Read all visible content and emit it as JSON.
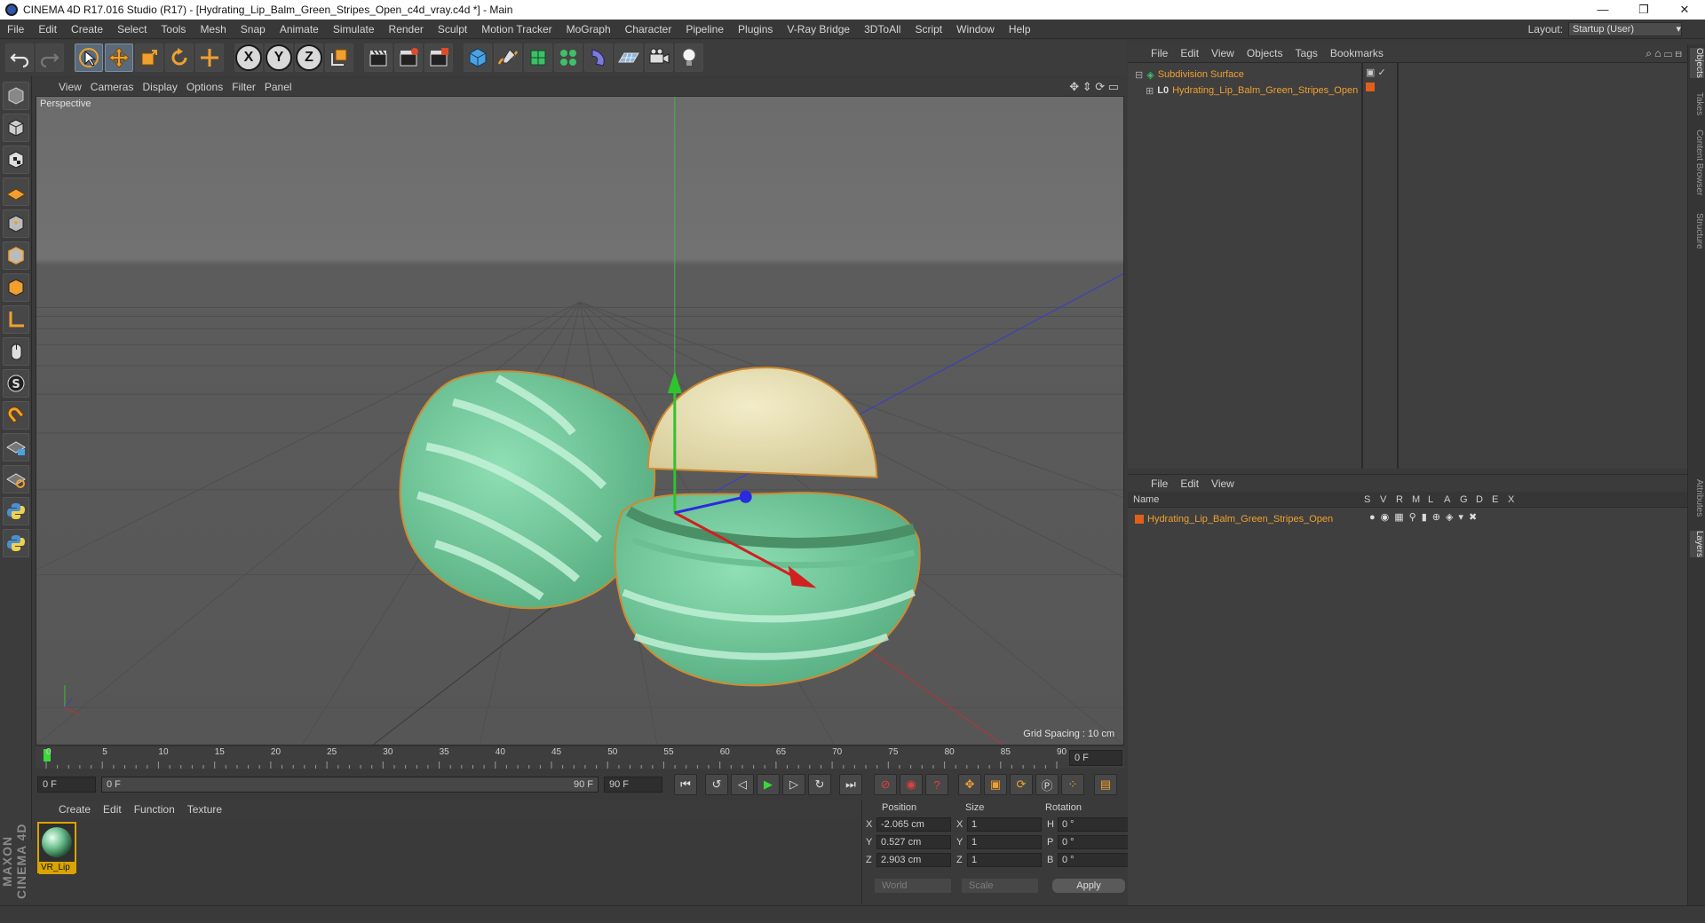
{
  "window": {
    "title": "CINEMA 4D R17.016 Studio (R17) - [Hydrating_Lip_Balm_Green_Stripes_Open_c4d_vray.c4d *] - Main",
    "controls": [
      "—",
      "❐",
      "✕"
    ]
  },
  "menu": {
    "items": [
      "File",
      "Edit",
      "Create",
      "Select",
      "Tools",
      "Mesh",
      "Snap",
      "Animate",
      "Simulate",
      "Render",
      "Sculpt",
      "Motion Tracker",
      "MoGraph",
      "Character",
      "Pipeline",
      "Plugins",
      "V-Ray Bridge",
      "3DToAll",
      "Script",
      "Window",
      "Help"
    ],
    "layout_label": "Layout:",
    "layout_value": "Startup (User)"
  },
  "toolbar": {
    "axis_x": "X",
    "axis_y": "Y",
    "axis_z": "Z"
  },
  "viewport": {
    "menu": [
      "View",
      "Cameras",
      "Display",
      "Options",
      "Filter",
      "Panel"
    ],
    "camera_label": "Perspective",
    "grid_spacing": "Grid Spacing : 10 cm"
  },
  "timeline": {
    "ticks": [
      "0",
      "5",
      "10",
      "15",
      "20",
      "25",
      "30",
      "35",
      "40",
      "45",
      "50",
      "55",
      "60",
      "65",
      "70",
      "75",
      "80",
      "85",
      "90"
    ],
    "current_frame": "0 F",
    "start_field": "0 F",
    "range_start": "0 F",
    "range_end": "90 F",
    "end_field": "90 F"
  },
  "materials": {
    "menu": [
      "Create",
      "Edit",
      "Function",
      "Texture"
    ],
    "items": [
      {
        "name": "VR_Lip"
      }
    ]
  },
  "coordinates": {
    "headers": {
      "position": "Position",
      "size": "Size",
      "rotation": "Rotation"
    },
    "rows": [
      {
        "axis": "X",
        "pos": "-2.065 cm",
        "size_axis": "X",
        "size": "1",
        "rot_axis": "H",
        "rot": "0 °"
      },
      {
        "axis": "Y",
        "pos": "0.527 cm",
        "size_axis": "Y",
        "size": "1",
        "rot_axis": "P",
        "rot": "0 °"
      },
      {
        "axis": "Z",
        "pos": "2.903 cm",
        "size_axis": "Z",
        "size": "1",
        "rot_axis": "B",
        "rot": "0 °"
      }
    ],
    "mode": "World",
    "size_mode": "Scale",
    "apply": "Apply"
  },
  "objects_panel": {
    "menu": [
      "File",
      "Edit",
      "View",
      "Objects",
      "Tags",
      "Bookmarks"
    ],
    "objects": [
      {
        "name": "Subdivision Surface"
      },
      {
        "name": "Hydrating_Lip_Balm_Green_Stripes_Open"
      }
    ]
  },
  "layers_panel": {
    "menu": [
      "File",
      "Edit",
      "View"
    ],
    "name_header": "Name",
    "columns": [
      "S",
      "V",
      "R",
      "M",
      "L",
      "A",
      "G",
      "D",
      "E",
      "X"
    ],
    "layers": [
      {
        "name": "Hydrating_Lip_Balm_Green_Stripes_Open"
      }
    ]
  },
  "side_tabs": [
    "Objects",
    "Takes",
    "Content Browser",
    "Structure",
    "Attributes",
    "Layers"
  ],
  "branding": "MAXON CINEMA 4D",
  "colors": {
    "accent_orange": "#f0a030",
    "balm_green": "#7fd4a4",
    "balm_cream": "#e8dfb6",
    "viewport_bg": "#5e5e5e"
  }
}
